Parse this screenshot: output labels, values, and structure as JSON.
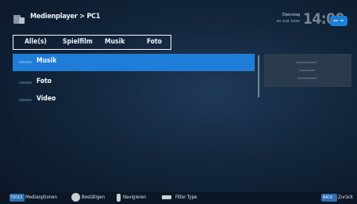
{
  "header": {
    "breadcrumb": "Medienplayer > PC1",
    "day": "Dienstag",
    "date": "xx xxx xxxx",
    "time": "14:00"
  },
  "filter_tabs": [
    "Alle(s)",
    "Spielfilm",
    "Musik",
    "Foto"
  ],
  "list": {
    "items": [
      {
        "label": "Musik",
        "selected": true
      },
      {
        "label": "Foto",
        "selected": false
      },
      {
        "label": "Video",
        "selected": false
      }
    ]
  },
  "footer": {
    "tools_key": "TOOLS",
    "mediaoptionen": "Mediaoptionen",
    "bestaetigen": "Bestätigen",
    "navigieren": "Navigieren",
    "filter_type": "Filter Type",
    "back_key": "BACK",
    "zurueck": "Zurück"
  },
  "colors": {
    "accent": "#1f7dd7",
    "background": "#13263d"
  }
}
